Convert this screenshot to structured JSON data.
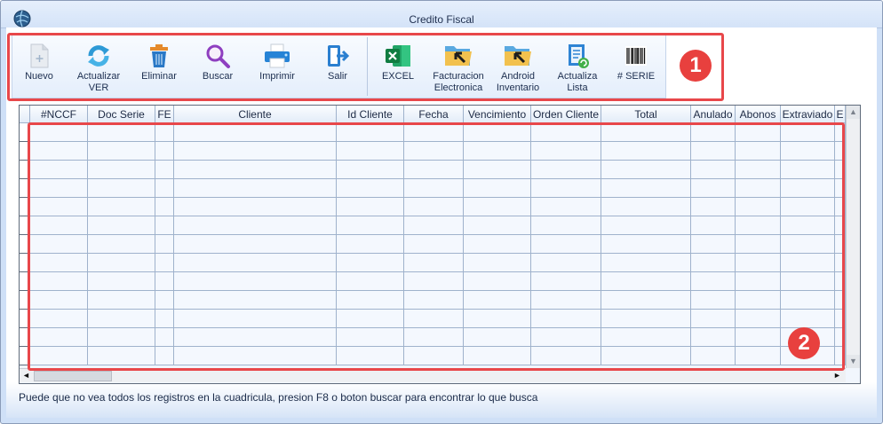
{
  "window": {
    "title": "Credito Fiscal"
  },
  "toolbar": {
    "buttons": [
      {
        "label": "Nuevo",
        "icon": "new-document-icon"
      },
      {
        "label": "Actualizar\nVER",
        "icon": "refresh-icon"
      },
      {
        "label": "Eliminar",
        "icon": "trash-icon"
      },
      {
        "label": "Buscar",
        "icon": "search-icon"
      },
      {
        "label": "Imprimir",
        "icon": "printer-icon"
      },
      {
        "label": "Salir",
        "icon": "exit-icon"
      },
      {
        "label": "EXCEL",
        "icon": "excel-icon"
      },
      {
        "label": "Facturacion\nElectronica",
        "icon": "folder-arrow-icon"
      },
      {
        "label": "Android\nInventario",
        "icon": "folder-arrow-icon"
      },
      {
        "label": "Actualiza\nLista",
        "icon": "list-refresh-icon"
      },
      {
        "label": "# SERIE",
        "icon": "barcode-icon"
      }
    ]
  },
  "grid": {
    "columns": [
      "#NCCF",
      "Doc Serie",
      "FE",
      "Cliente",
      "Id Cliente",
      "Fecha",
      "Vencimiento",
      "Orden Cliente",
      "Total",
      "Anulado",
      "Abonos",
      "Extraviado",
      "E"
    ]
  },
  "annotations": {
    "one": "1",
    "two": "2"
  },
  "status": {
    "message": "Puede que no vea todos los registros en la cuadricula, presion F8 o boton buscar para encontrar lo que busca"
  },
  "colors": {
    "annotation": "#e8474a",
    "title_bar": "#d4e3f8",
    "grid_line": "#9fb2cc"
  }
}
